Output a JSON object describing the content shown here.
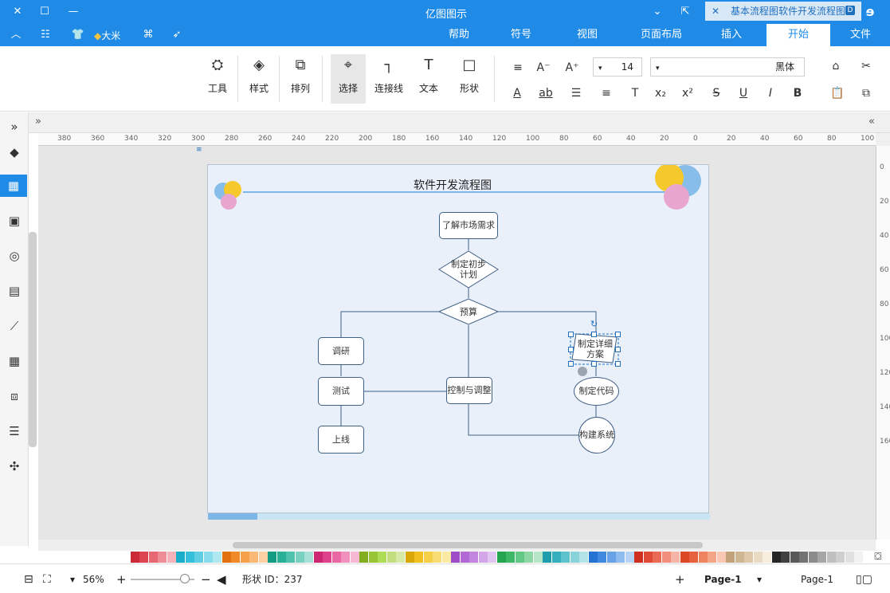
{
  "app": {
    "title": "亿图图示",
    "window_controls": {
      "close": "✕",
      "maximize": "☐",
      "minimize": "—"
    }
  },
  "menu": {
    "tabs": [
      "文件",
      "开始",
      "插入",
      "页面布局",
      "视图",
      "符号",
      "帮助"
    ],
    "active": "开始",
    "left_tools": {
      "collapse": "︿",
      "apps": "☷",
      "skin": "👕",
      "user": "大米",
      "share": "⌘",
      "publish": "➶"
    }
  },
  "ribbon": {
    "buttons": [
      {
        "label": "形状",
        "icon": "□"
      },
      {
        "label": "文本",
        "icon": "T"
      },
      {
        "label": "连接线",
        "icon": "┐"
      },
      {
        "label": "选择",
        "icon": "⌖"
      },
      {
        "label": "排列",
        "icon": "⧉"
      },
      {
        "label": "样式",
        "icon": "◈"
      },
      {
        "label": "工具",
        "icon": "⛭"
      }
    ],
    "font_name": "黑体",
    "font_size": "14",
    "format_row1": [
      "A⁺",
      "A⁻",
      "≡"
    ],
    "format_row2": [
      "B",
      "I",
      "U",
      "S",
      "x²",
      "x₂",
      "T",
      "≡",
      "☰",
      "ab",
      "A"
    ]
  },
  "sidebar": {
    "icons": [
      "»",
      "◆",
      "▦",
      "▣",
      "◎",
      "▤",
      "⟋",
      "▦",
      "⧈",
      "☰",
      "✣"
    ],
    "active_index": 2
  },
  "document_tab": {
    "title": "基本流程图软件开发流程图",
    "close": "✕"
  },
  "ruler": {
    "h_labels": [
      "100",
      "80",
      "60",
      "40",
      "20",
      "0",
      "20",
      "40",
      "60",
      "80",
      "100",
      "120",
      "140",
      "160",
      "180",
      "200",
      "220",
      "240",
      "260",
      "280",
      "300",
      "320",
      "340",
      "360",
      "380"
    ],
    "v_labels": [
      "0",
      "20",
      "40",
      "60",
      "80",
      "100",
      "120",
      "140",
      "160"
    ]
  },
  "diagram": {
    "title": "软件开发流程图",
    "nodes": {
      "n1": "了解市场需求",
      "n2": "制定初步计划",
      "n3": "预算",
      "n4": "调研",
      "n5": "测试",
      "n6": "上线",
      "n7": "控制与调整",
      "n8": "制定详细方案",
      "n9": "制定代码",
      "n10": "构建系统"
    }
  },
  "palette": {
    "colors": [
      "#f2f2f2",
      "#e0e0e0",
      "#cfcfcf",
      "#bfbfbf",
      "#a6a6a6",
      "#8c8c8c",
      "#737373",
      "#595959",
      "#404040",
      "#262626",
      "#f7eedd",
      "#eadcc4",
      "#ddc9aa",
      "#cfb692",
      "#c2a379",
      "#f9c7b3",
      "#f4a586",
      "#ee8360",
      "#e6623f",
      "#dc4823",
      "#f7b5a8",
      "#f28e7c",
      "#ea6a55",
      "#df4a36",
      "#cf2f20",
      "#b5d3f4",
      "#8fbcee",
      "#67a3e6",
      "#3f8adf",
      "#2472d1",
      "#b3e3e7",
      "#88d3da",
      "#5dc2cc",
      "#36b0bd",
      "#1f9dab",
      "#b6e6c5",
      "#8dd7a4",
      "#63c884",
      "#3eb866",
      "#25a54f",
      "#e2c5f0",
      "#d3a6e8",
      "#c386df",
      "#b268d5",
      "#9e4cc7",
      "#fbeaa3",
      "#f8dd75",
      "#f5cf47",
      "#f1c01e",
      "#d9a808",
      "#d6e9a7",
      "#c2de7f",
      "#addd57",
      "#98c534",
      "#82ad1f",
      "#f7b8d3",
      "#f190bc",
      "#e968a4",
      "#df428c",
      "#cc2773",
      "#a6e0d6",
      "#7ad1c2",
      "#4fc2ae",
      "#2ab097",
      "#139c81",
      "#fbd1a3",
      "#f8b977",
      "#f5a14c",
      "#f08a26",
      "#e2720f",
      "#b0e8f2",
      "#88dbeb",
      "#5fcde3",
      "#36bfdb",
      "#1aadc9",
      "#f5b3b9",
      "#ef8d96",
      "#e76873",
      "#de4553",
      "#cc2a39"
    ]
  },
  "status": {
    "page_label": "Page-1",
    "page_tab": "Page-1",
    "shape_id": "形状 ID：237",
    "zoom": "56%"
  }
}
